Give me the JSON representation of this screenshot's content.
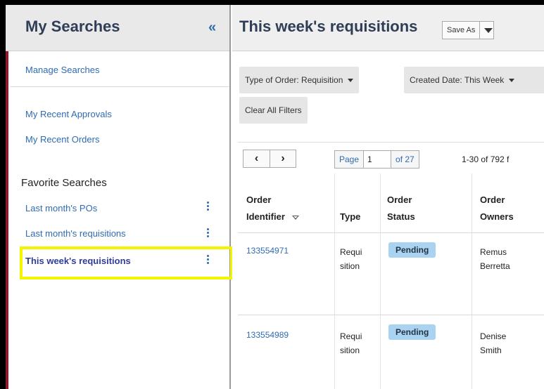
{
  "sidebar": {
    "title": "My Searches",
    "collapse_icon": "«",
    "links": {
      "manage": "Manage Searches",
      "recent_approvals": "My Recent Approvals",
      "recent_orders": "My Recent Orders"
    },
    "favorites_heading": "Favorite Searches",
    "favorites": [
      {
        "label": "Last month's POs"
      },
      {
        "label": "Last month's requisitions"
      },
      {
        "label": "This week's requisitions"
      }
    ]
  },
  "main": {
    "title": "This week's requisitions",
    "save_as": "Save As",
    "filters": [
      {
        "label": "Type of Order: Requisition"
      },
      {
        "label": "Created Date: This Week"
      }
    ],
    "clear_filters": "Clear All Filters",
    "pager": {
      "prev_icon": "‹",
      "next_icon": "›",
      "page_label": "Page",
      "page_value": "1",
      "of_label": "of 27",
      "range": "1-30 of 792 f"
    },
    "table": {
      "headers": {
        "order_identifier_1": "Order",
        "order_identifier_2": "Identifier",
        "type": "Type",
        "status_1": "Order",
        "status_2": "Status",
        "owners_1": "Order",
        "owners_2": "Owners"
      },
      "rows": [
        {
          "id": "133554971",
          "type_1": "Requi",
          "type_2": "sition",
          "status": "Pending",
          "owner_1": "Remus",
          "owner_2": "Berretta"
        },
        {
          "id": "133554989",
          "type_1": "Requi",
          "type_2": "sition",
          "status": "Pending",
          "owner_1": "Denise",
          "owner_2": "Smith"
        }
      ]
    }
  },
  "colors": {
    "accent_link": "#2f6bb3",
    "title": "#2f3d56",
    "highlight": "#f4f300",
    "badge": "#a9d3f0",
    "sidebar_accent": "#8c1c2c"
  }
}
